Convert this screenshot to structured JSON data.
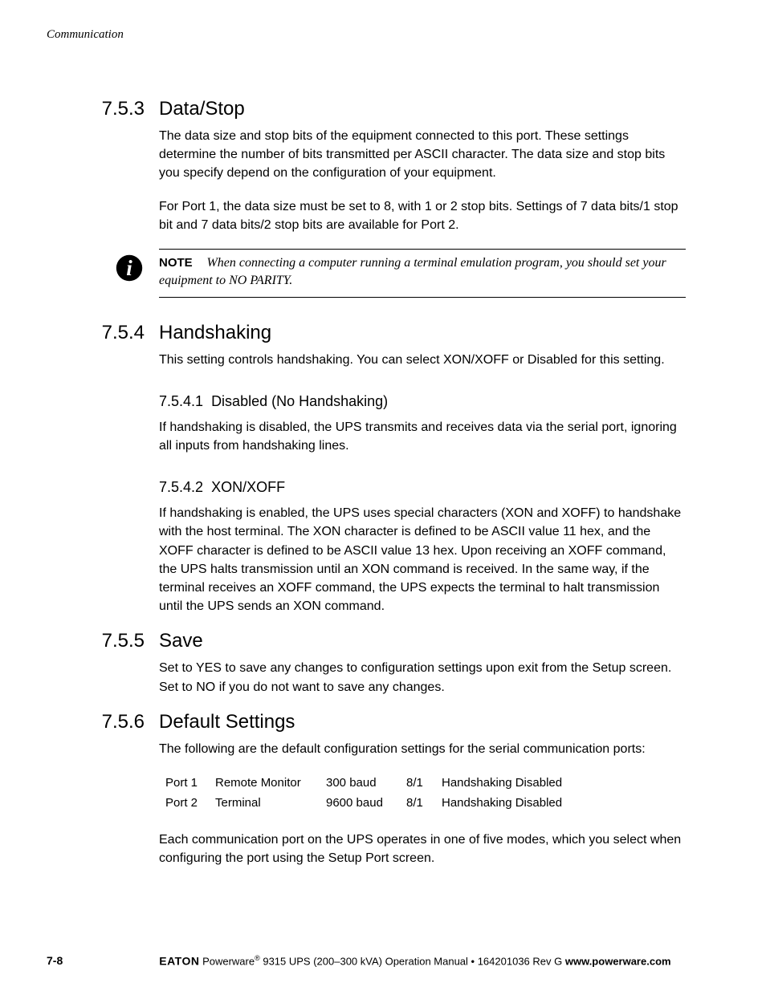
{
  "running_head": "Communication",
  "sections": {
    "s753": {
      "num": "7.5.3",
      "title": "Data/Stop",
      "p1": "The data size and stop bits of the equipment connected to this port. These settings determine the number of bits transmitted per ASCII character. The data size and stop bits you specify depend on the configuration of your equipment.",
      "p2": "For Port 1, the data size must be set to 8, with 1 or 2 stop bits. Settings of 7 data bits/1 stop bit and 7 data bits/2 stop bits are available for Port 2."
    },
    "note": {
      "label": "NOTE",
      "text": "When connecting a computer running a terminal emulation program, you should set your equipment to NO PARITY."
    },
    "s754": {
      "num": "7.5.4",
      "title": "Handshaking",
      "p1": "This setting controls handshaking. You can select XON/XOFF or Disabled for this setting.",
      "sub1": {
        "num": "7.5.4.1",
        "title": "Disabled (No Handshaking)",
        "p": "If handshaking is disabled, the UPS transmits and receives data via the serial port, ignoring all inputs from handshaking lines."
      },
      "sub2": {
        "num": "7.5.4.2",
        "title": "XON/XOFF",
        "p": "If handshaking is enabled, the UPS uses special characters (XON and XOFF) to handshake with the host terminal. The XON character is defined to be ASCII value 11 hex, and the XOFF character is defined to be ASCII value 13 hex. Upon receiving an XOFF command, the UPS halts transmission until an XON command is received. In the same way, if the terminal receives an XOFF command, the UPS expects the terminal to halt transmission until the UPS sends an XON command."
      }
    },
    "s755": {
      "num": "7.5.5",
      "title": "Save",
      "p1": "Set to YES to save any changes to configuration settings upon exit from the Setup screen. Set to NO if you do not want to save any changes."
    },
    "s756": {
      "num": "7.5.6",
      "title": "Default Settings",
      "p1": "The following are the default configuration settings for the serial communication ports:",
      "table": [
        {
          "port": "Port 1",
          "mode": "Remote Monitor",
          "baud": "300 baud",
          "bits": "8/1",
          "hs": "Handshaking Disabled"
        },
        {
          "port": "Port 2",
          "mode": "Terminal",
          "baud": "9600 baud",
          "bits": "8/1",
          "hs": "Handshaking Disabled"
        }
      ],
      "p2": "Each communication port on the UPS operates in one of five modes, which you select when configuring the port using the Setup Port screen."
    }
  },
  "footer": {
    "page": "7-8",
    "brand": "EATON",
    "product_prefix": " Powerware",
    "product_suffix": " 9315 UPS (200–300 kVA) Operation Manual  •  164201036 Rev G  ",
    "url": "www.powerware.com"
  }
}
